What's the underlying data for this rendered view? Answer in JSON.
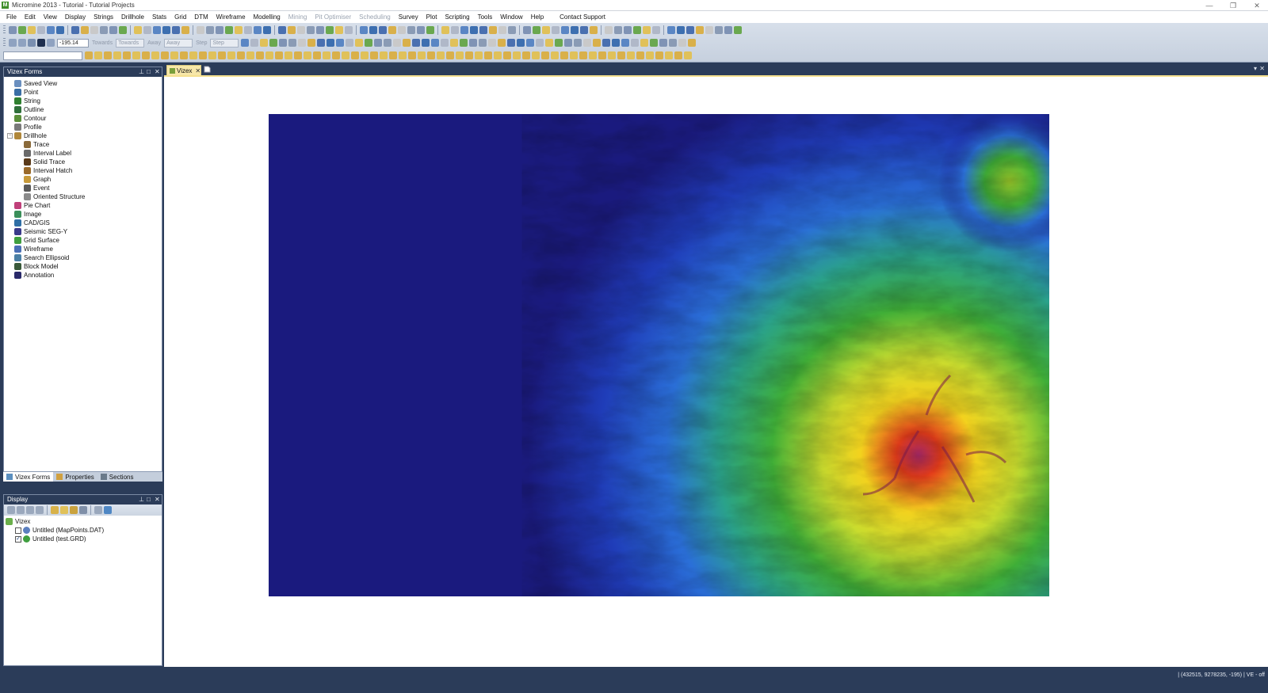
{
  "window": {
    "title": "Micromine 2013 - Tutorial - Tutorial Projects",
    "icon": "micromine-app-icon",
    "minimize": "—",
    "maximize": "❐",
    "close": "✕"
  },
  "menu": {
    "items": [
      {
        "label": "File",
        "enabled": true
      },
      {
        "label": "Edit",
        "enabled": true
      },
      {
        "label": "View",
        "enabled": true
      },
      {
        "label": "Display",
        "enabled": true
      },
      {
        "label": "Strings",
        "enabled": true
      },
      {
        "label": "Drillhole",
        "enabled": true
      },
      {
        "label": "Stats",
        "enabled": true
      },
      {
        "label": "Grid",
        "enabled": true
      },
      {
        "label": "DTM",
        "enabled": true
      },
      {
        "label": "Wireframe",
        "enabled": true
      },
      {
        "label": "Modelling",
        "enabled": true
      },
      {
        "label": "Mining",
        "enabled": false
      },
      {
        "label": "Pit Optimiser",
        "enabled": false
      },
      {
        "label": "Scheduling",
        "enabled": false
      },
      {
        "label": "Survey",
        "enabled": true
      },
      {
        "label": "Plot",
        "enabled": true
      },
      {
        "label": "Scripting",
        "enabled": true
      },
      {
        "label": "Tools",
        "enabled": true
      },
      {
        "label": "Window",
        "enabled": true
      },
      {
        "label": "Help",
        "enabled": true
      }
    ],
    "contact_support": "Contact Support"
  },
  "toolbar": {
    "elevation_value": "-195.14",
    "towards_label": "Towards",
    "towards_combo": "Towards",
    "away_label": "Away",
    "away_combo": "Away",
    "step_label": "Step",
    "step_combo": "Step",
    "row3_input": ""
  },
  "vizex_forms": {
    "title": "Vizex Forms",
    "pin": "⊥",
    "float": "□",
    "close": "✕",
    "items": [
      {
        "label": "Saved View",
        "icon": "saved-view-icon",
        "color": "#6a8fbf",
        "level": 0
      },
      {
        "label": "Point",
        "icon": "point-icon",
        "color": "#3a6ea5",
        "level": 0
      },
      {
        "label": "String",
        "icon": "string-icon",
        "color": "#2f7f2f",
        "level": 0
      },
      {
        "label": "Outline",
        "icon": "outline-icon",
        "color": "#2f6f3a",
        "level": 0
      },
      {
        "label": "Contour",
        "icon": "contour-icon",
        "color": "#5b8f3a",
        "level": 0
      },
      {
        "label": "Profile",
        "icon": "profile-icon",
        "color": "#7a7a7a",
        "level": 0
      },
      {
        "label": "Drillhole",
        "icon": "drillhole-icon",
        "color": "#b0873a",
        "level": 0
      },
      {
        "label": "Trace",
        "icon": "trace-icon",
        "color": "#8a6a3a",
        "level": 1
      },
      {
        "label": "Interval Label",
        "icon": "interval-label-icon",
        "color": "#6a6a6a",
        "level": 1
      },
      {
        "label": "Solid Trace",
        "icon": "solid-trace-icon",
        "color": "#5a3a1a",
        "level": 1
      },
      {
        "label": "Interval Hatch",
        "icon": "interval-hatch-icon",
        "color": "#9a6a2a",
        "level": 1
      },
      {
        "label": "Graph",
        "icon": "graph-icon",
        "color": "#c79a3a",
        "level": 1
      },
      {
        "label": "Event",
        "icon": "event-icon",
        "color": "#5a5a5a",
        "level": 1
      },
      {
        "label": "Oriented Structure",
        "icon": "oriented-structure-icon",
        "color": "#8a8a8a",
        "level": 1
      },
      {
        "label": "Pie Chart",
        "icon": "pie-chart-icon",
        "color": "#c0407a",
        "level": 0
      },
      {
        "label": "Image",
        "icon": "image-icon",
        "color": "#3a8f5a",
        "level": 0
      },
      {
        "label": "CAD/GIS",
        "icon": "cad-gis-icon",
        "color": "#2f6fa5",
        "level": 0
      },
      {
        "label": "Seismic SEG-Y",
        "icon": "seismic-icon",
        "color": "#3a3a8a",
        "level": 0
      },
      {
        "label": "Grid Surface",
        "icon": "grid-surface-icon",
        "color": "#3f9f3f",
        "level": 0
      },
      {
        "label": "Wireframe",
        "icon": "wireframe-icon",
        "color": "#4a6fb5",
        "level": 0
      },
      {
        "label": "Search Ellipsoid",
        "icon": "search-ellipsoid-icon",
        "color": "#4a7fa5",
        "level": 0
      },
      {
        "label": "Block Model",
        "icon": "block-model-icon",
        "color": "#3a5a3a",
        "level": 0
      },
      {
        "label": "Annotation",
        "icon": "annotation-icon",
        "color": "#2a2a6a",
        "level": 0
      }
    ],
    "tabs": [
      {
        "label": "Vizex Forms",
        "icon": "vizex-forms-tab-icon",
        "active": true
      },
      {
        "label": "Properties",
        "icon": "properties-tab-icon",
        "active": false
      },
      {
        "label": "Sections",
        "icon": "sections-tab-icon",
        "active": false
      }
    ]
  },
  "display_panel": {
    "title": "Display",
    "pin": "⊥",
    "float": "□",
    "close": "✕",
    "root": "Vizex",
    "layers": [
      {
        "label": "Untitled (MapPoints.DAT)",
        "checked": false,
        "icon": "point-layer-icon"
      },
      {
        "label": "Untitled (test.GRD)",
        "checked": true,
        "icon": "grid-layer-icon"
      }
    ]
  },
  "document": {
    "tab_label": "Vizex",
    "tab_close": "✕",
    "dropdown": "▾",
    "close": "✕"
  },
  "map": {
    "background_color": "#1a1a7e",
    "colormap": [
      "#1a1a7e",
      "#1c2fb0",
      "#2255e0",
      "#2a8ad8",
      "#37b08a",
      "#3fae37",
      "#8fcb2a",
      "#d9e13a",
      "#f3d21e",
      "#e33b1a",
      "#b02a6a"
    ]
  },
  "status": {
    "coordinates": "(432515, 9278235, -195)",
    "ve": "VE - off"
  },
  "colors": {
    "dark_chrome": "#2b3c59",
    "toolbar_bg": "#cdd6e3",
    "active_tab": "#f7e7a8"
  }
}
